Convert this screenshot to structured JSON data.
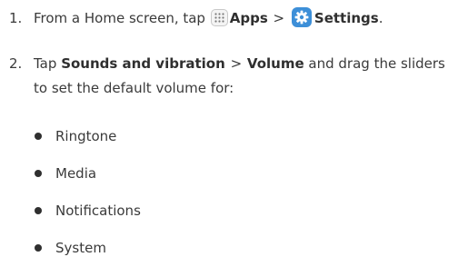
{
  "steps": [
    {
      "number": "1.",
      "text_before": "From a Home screen, tap",
      "apps_label": "Apps",
      "separator": ">",
      "settings_label": "Settings",
      "end": "."
    },
    {
      "number": "2.",
      "text_before": "Tap",
      "sounds_label": "Sounds and vibration",
      "separator": ">",
      "volume_label": "Volume",
      "text_after": "and drag the sliders to set the default volume for:"
    }
  ],
  "bullets": [
    "Ringtone",
    "Media",
    "Notifications",
    "System"
  ],
  "colors": {
    "text": "#3a3a3a",
    "settings_icon_bg": "#3d8fd8"
  },
  "icons": [
    "apps-grid-icon",
    "settings-gear-icon"
  ]
}
